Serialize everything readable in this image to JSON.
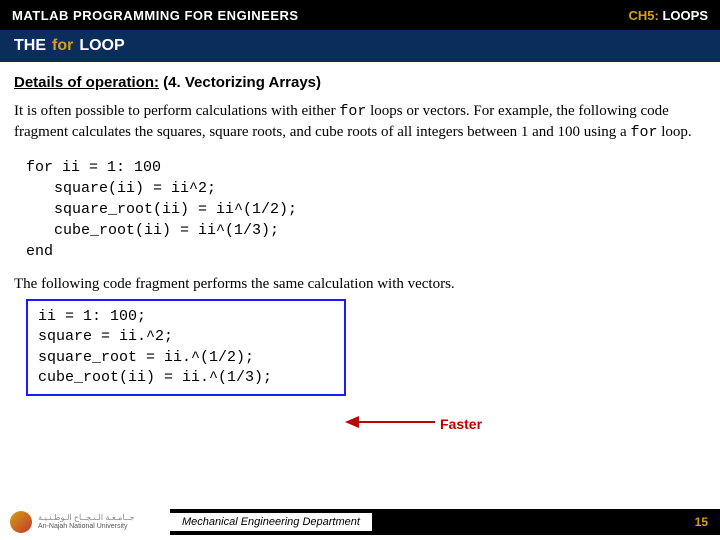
{
  "header": {
    "left": "MATLAB PROGRAMMING FOR ENGINEERS",
    "right_ch": "CH5:",
    "right_loops": " LOOPS"
  },
  "title": {
    "the": "THE",
    "for": "for",
    "loop": "LOOP"
  },
  "subtitle_underline": "Details of operation:",
  "subtitle_rest": " (4. Vectorizing Arrays)",
  "paragraph1_part1": "It is often possible to perform calculations with either ",
  "paragraph1_for": "for",
  "paragraph1_part2": " loops or vectors. For example, the following code fragment calculates the squares, square roots, and cube roots of all integers between 1 and 100 using a ",
  "paragraph1_for2": "for",
  "paragraph1_part3": " loop.",
  "code1": {
    "l1": "for ii = 1: 100",
    "l2": "square(ii) = ii^2;",
    "l3": "square_root(ii) = ii^(1/2);",
    "l4": "cube_root(ii) = ii^(1/3);",
    "l5": "end"
  },
  "paragraph2": "The following code fragment performs the same calculation with vectors.",
  "code2": {
    "l1": "ii = 1: 100;",
    "l2": "square = ii.^2;",
    "l3": "square_root = ii.^(1/2);",
    "l4": "cube_root(ii) = ii.^(1/3);"
  },
  "faster": "Faster",
  "logo": {
    "arabic": "جــامـعـة الـنـجــاح الـوطـنـيـة",
    "english": "An-Najah National University"
  },
  "footer": {
    "dept": "Mechanical Engineering Department",
    "page": "15"
  },
  "chart_data": null
}
